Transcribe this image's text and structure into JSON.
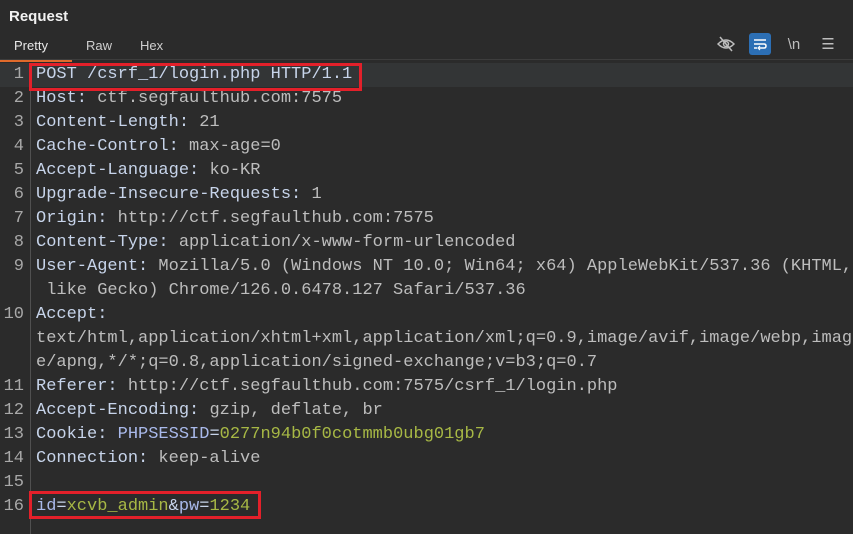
{
  "panel": {
    "title": "Request"
  },
  "tabs": [
    {
      "label": "Pretty"
    },
    {
      "label": "Raw"
    },
    {
      "label": "Hex"
    }
  ],
  "toolbar": {
    "hide_icon": "eye-off-icon",
    "wrap_icon": "word-wrap-icon",
    "newline_label": "\\n",
    "menu_icon": "hamburger-menu-icon",
    "accent": "#2c6fb5"
  },
  "rows": [
    {
      "ln": "1",
      "segs": [
        {
          "t": "POST /csrf_1/login.php HTTP/1.1",
          "c": "k"
        }
      ]
    },
    {
      "ln": "2",
      "segs": [
        {
          "t": "Host: ",
          "c": "k"
        },
        {
          "t": "ctf.segfaulthub.com:7575",
          "c": "v"
        }
      ]
    },
    {
      "ln": "3",
      "segs": [
        {
          "t": "Content-Length: ",
          "c": "k"
        },
        {
          "t": "21",
          "c": "v"
        }
      ]
    },
    {
      "ln": "4",
      "segs": [
        {
          "t": "Cache-Control: ",
          "c": "k"
        },
        {
          "t": "max-age=0",
          "c": "v"
        }
      ]
    },
    {
      "ln": "5",
      "segs": [
        {
          "t": "Accept-Language: ",
          "c": "k"
        },
        {
          "t": "ko-KR",
          "c": "v"
        }
      ]
    },
    {
      "ln": "6",
      "segs": [
        {
          "t": "Upgrade-Insecure-Requests: ",
          "c": "k"
        },
        {
          "t": "1",
          "c": "v"
        }
      ]
    },
    {
      "ln": "7",
      "segs": [
        {
          "t": "Origin: ",
          "c": "k"
        },
        {
          "t": "http://ctf.segfaulthub.com:7575",
          "c": "v"
        }
      ]
    },
    {
      "ln": "8",
      "segs": [
        {
          "t": "Content-Type: ",
          "c": "k"
        },
        {
          "t": "application/x-www-form-urlencoded",
          "c": "v"
        }
      ]
    },
    {
      "ln": "9",
      "segs": [
        {
          "t": "User-Agent: ",
          "c": "k"
        },
        {
          "t": "Mozilla/5.0 (Windows NT 10.0; Win64; x64) AppleWebKit/537.36 (KHTML,",
          "c": "v"
        }
      ]
    },
    {
      "ln": "",
      "segs": [
        {
          "t": " like Gecko) Chrome/126.0.6478.127 Safari/537.36",
          "c": "v"
        }
      ]
    },
    {
      "ln": "10",
      "segs": [
        {
          "t": "Accept:",
          "c": "k"
        }
      ]
    },
    {
      "ln": "",
      "segs": [
        {
          "t": "text/html,application/xhtml+xml,application/xml;q=0.9,image/avif,image/webp,imag",
          "c": "v"
        }
      ]
    },
    {
      "ln": "",
      "segs": [
        {
          "t": "e/apng,*/*;q=0.8,application/signed-exchange;v=b3;q=0.7",
          "c": "v"
        }
      ]
    },
    {
      "ln": "11",
      "segs": [
        {
          "t": "Referer: ",
          "c": "k"
        },
        {
          "t": "http://ctf.segfaulthub.com:7575/csrf_1/login.php",
          "c": "v"
        }
      ]
    },
    {
      "ln": "12",
      "segs": [
        {
          "t": "Accept-Encoding: ",
          "c": "k"
        },
        {
          "t": "gzip, deflate, br",
          "c": "v"
        }
      ]
    },
    {
      "ln": "13",
      "segs": [
        {
          "t": "Cookie: ",
          "c": "k"
        },
        {
          "t": "PHPSESSID",
          "c": "n"
        },
        {
          "t": "=",
          "c": "k"
        },
        {
          "t": "0277n94b0f0cotmmb0ubg01gb7",
          "c": "g"
        }
      ]
    },
    {
      "ln": "14",
      "segs": [
        {
          "t": "Connection: ",
          "c": "k"
        },
        {
          "t": "keep-alive",
          "c": "v"
        }
      ]
    },
    {
      "ln": "15",
      "segs": []
    },
    {
      "ln": "16",
      "segs": [
        {
          "t": "id",
          "c": "n"
        },
        {
          "t": "=",
          "c": "k"
        },
        {
          "t": "xcvb_admin",
          "c": "g"
        },
        {
          "t": "&",
          "c": "k"
        },
        {
          "t": "pw",
          "c": "n"
        },
        {
          "t": "=",
          "c": "k"
        },
        {
          "t": "1234",
          "c": "g"
        }
      ]
    }
  ]
}
